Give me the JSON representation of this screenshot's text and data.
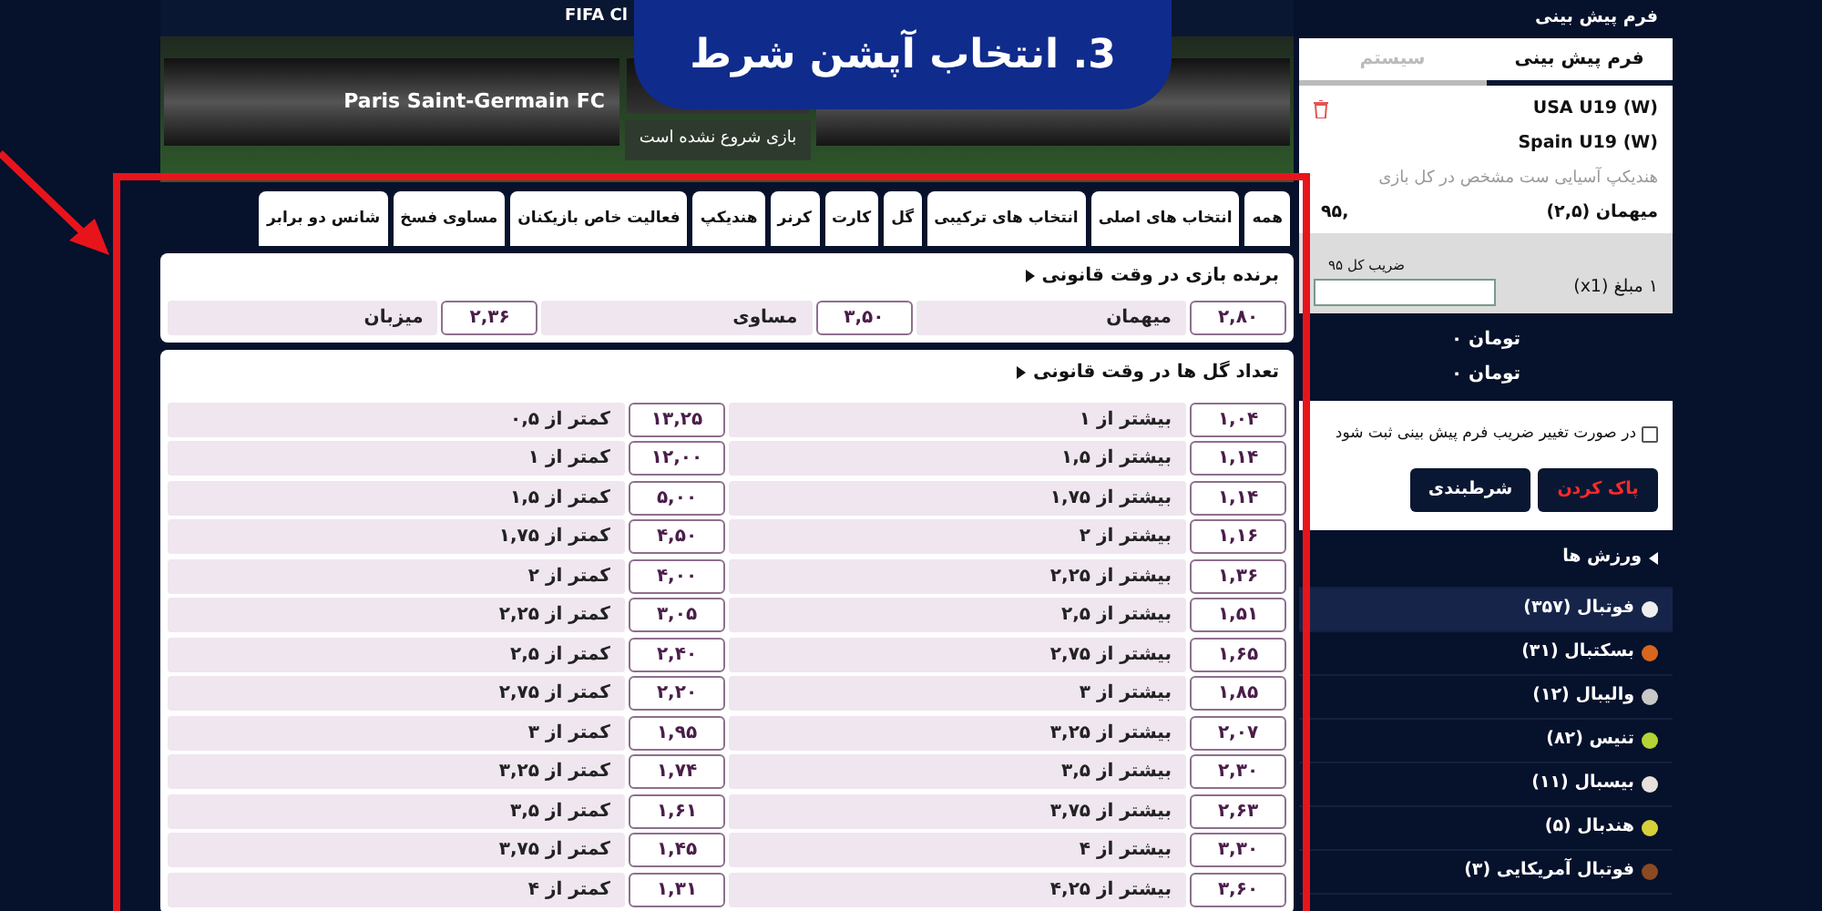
{
  "annotation": {
    "step_banner": "3. انتخاب آپشن شرط"
  },
  "match": {
    "competition": "FIFA Cl",
    "home_team": "Paris Saint-Germain FC",
    "status": "بازی شروع نشده است"
  },
  "market_tabs": [
    {
      "label": "همه",
      "selected": false
    },
    {
      "label": "انتخاب های اصلی",
      "selected": false
    },
    {
      "label": "انتخاب های ترکیبی",
      "selected": false
    },
    {
      "label": "گل",
      "selected": false
    },
    {
      "label": "کارت",
      "selected": false
    },
    {
      "label": "کرنر",
      "selected": false
    },
    {
      "label": "هندیکپ",
      "selected": false
    },
    {
      "label": "فعالیت خاص بازیکنان",
      "selected": false
    },
    {
      "label": "مساوی فسخ",
      "selected": false
    },
    {
      "label": "شانس دو برابر",
      "selected": false
    }
  ],
  "markets": [
    {
      "kind": "three_way",
      "title": "برنده بازی در وقت قانونی",
      "options": [
        {
          "label": "میهمان",
          "odds": "۲,۸۰"
        },
        {
          "label": "مساوی",
          "odds": "۳,۵۰"
        },
        {
          "label": "میزبان",
          "odds": "۲,۳۶"
        }
      ]
    },
    {
      "kind": "two_column",
      "title": "تعداد گل ها در وقت قانونی",
      "rows": [
        {
          "over": {
            "label": "بیشتر از ۱",
            "odds": "۱,۰۴"
          },
          "under": {
            "label": "کمتر از ۰,۵",
            "odds": "۱۳,۲۵"
          }
        },
        {
          "over": {
            "label": "بیشتر از ۱,۵",
            "odds": "۱,۱۴"
          },
          "under": {
            "label": "کمتر از ۱",
            "odds": "۱۲,۰۰"
          }
        },
        {
          "over": {
            "label": "بیشتر از ۱,۷۵",
            "odds": "۱,۱۴"
          },
          "under": {
            "label": "کمتر از ۱,۵",
            "odds": "۵,۰۰"
          }
        },
        {
          "over": {
            "label": "بیشتر از ۲",
            "odds": "۱,۱۶"
          },
          "under": {
            "label": "کمتر از ۱,۷۵",
            "odds": "۴,۵۰"
          }
        },
        {
          "over": {
            "label": "بیشتر از ۲,۲۵",
            "odds": "۱,۳۶"
          },
          "under": {
            "label": "کمتر از ۲",
            "odds": "۴,۰۰"
          }
        },
        {
          "over": {
            "label": "بیشتر از ۲,۵",
            "odds": "۱,۵۱"
          },
          "under": {
            "label": "کمتر از ۲,۲۵",
            "odds": "۳,۰۵"
          }
        },
        {
          "over": {
            "label": "بیشتر از ۲,۷۵",
            "odds": "۱,۶۵"
          },
          "under": {
            "label": "کمتر از ۲,۵",
            "odds": "۲,۴۰"
          }
        },
        {
          "over": {
            "label": "بیشتر از ۳",
            "odds": "۱,۸۵"
          },
          "under": {
            "label": "کمتر از ۲,۷۵",
            "odds": "۲,۲۰"
          }
        },
        {
          "over": {
            "label": "بیشتر از ۳,۲۵",
            "odds": "۲,۰۷"
          },
          "under": {
            "label": "کمتر از ۳",
            "odds": "۱,۹۵"
          }
        },
        {
          "over": {
            "label": "بیشتر از ۳,۵",
            "odds": "۲,۳۰"
          },
          "under": {
            "label": "کمتر از ۳,۲۵",
            "odds": "۱,۷۴"
          }
        },
        {
          "over": {
            "label": "بیشتر از ۳,۷۵",
            "odds": "۲,۶۳"
          },
          "under": {
            "label": "کمتر از ۳,۵",
            "odds": "۱,۶۱"
          }
        },
        {
          "over": {
            "label": "بیشتر از ۴",
            "odds": "۳,۳۰"
          },
          "under": {
            "label": "کمتر از ۳,۷۵",
            "odds": "۱,۴۵"
          }
        },
        {
          "over": {
            "label": "بیشتر از ۴,۲۵",
            "odds": "۳,۶۰"
          },
          "under": {
            "label": "کمتر از ۴",
            "odds": "۱,۳۱"
          }
        }
      ]
    }
  ],
  "betslip": {
    "title": "فرم پیش بینی",
    "tabs": [
      {
        "label": "فرم پیش بینی",
        "selected": true
      },
      {
        "label": "سیستم",
        "selected": false
      }
    ],
    "selection": {
      "team_1": "USA U19 (W)",
      "team_2": "Spain U19 (W)",
      "market": "هندیکپ آسیایی ست مشخص در کل بازی",
      "pick": "میهمان (۲,۵)",
      "odds": ",۹۵"
    },
    "total_odds_label": "ضریب کل ۹۵",
    "stake_label": "۱ مبلغ (x1)",
    "totals": [
      "تومان ۰",
      "تومان ۰"
    ],
    "accept_changes": {
      "label": "در صورت تغییر ضریب فرم پیش بینی ثبت شود",
      "checked": false
    },
    "buttons": [
      {
        "label": "پاک کردن",
        "kind": "danger"
      },
      {
        "label": "شرطبندی",
        "kind": "primary"
      }
    ]
  },
  "sports": {
    "title": "ورزش ها",
    "items": [
      {
        "name": "فوتبال (۳۵۷)",
        "color": "#eeeeee",
        "selected": true
      },
      {
        "name": "بسکتبال (۳۱)",
        "color": "#d9661f",
        "selected": false
      },
      {
        "name": "والیبال (۱۲)",
        "color": "#c8c8c8",
        "selected": false
      },
      {
        "name": "تنیس (۸۲)",
        "color": "#b5d334",
        "selected": false
      },
      {
        "name": "بیسبال (۱۱)",
        "color": "#e6e1dc",
        "selected": false
      },
      {
        "name": "هندبال (۵)",
        "color": "#d8d03a",
        "selected": false
      },
      {
        "name": "فوتبال آمریکایی (۳)",
        "color": "#8b4a22",
        "selected": false
      }
    ]
  }
}
